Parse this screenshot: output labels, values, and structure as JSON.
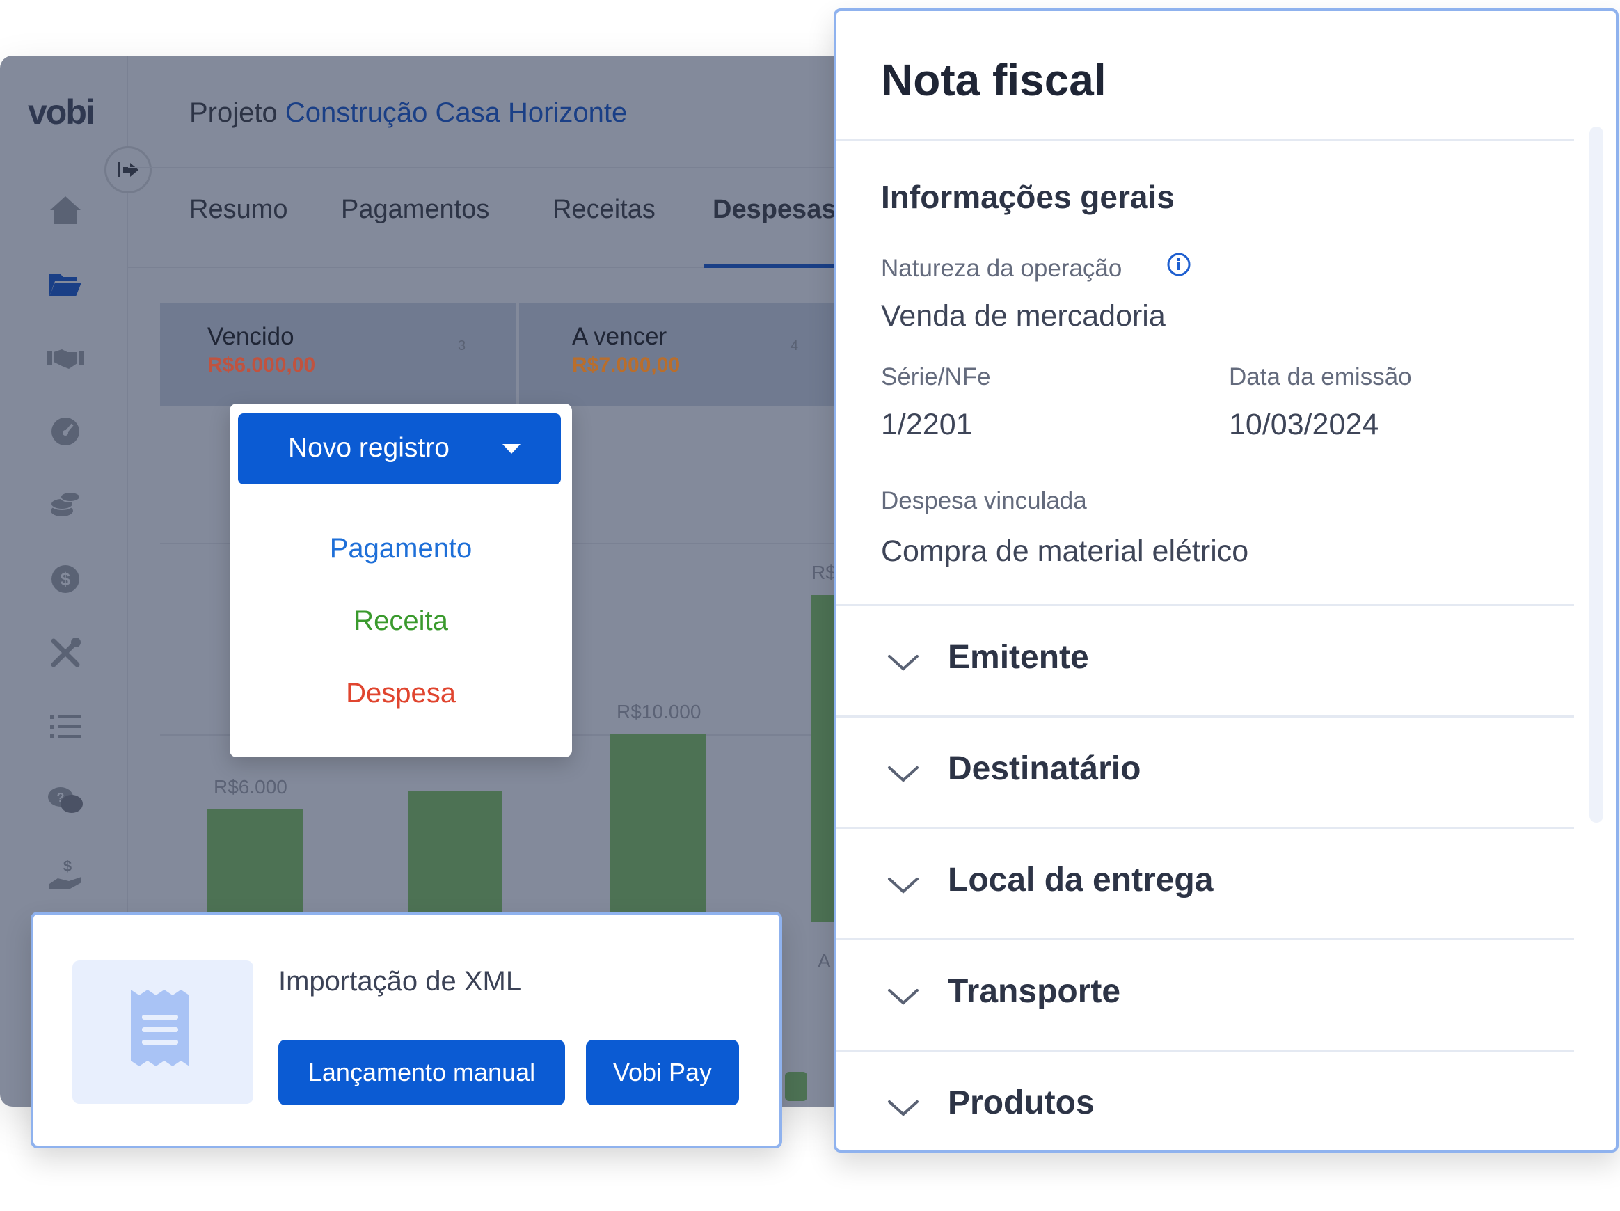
{
  "app": {
    "logo": "vobi",
    "project_prefix": "Projeto",
    "project_name": "Construção Casa Horizonte",
    "tabs": [
      {
        "label": "Resumo"
      },
      {
        "label": "Pagamentos"
      },
      {
        "label": "Receitas"
      },
      {
        "label": "Despesas"
      }
    ],
    "active_tab": "Despesas",
    "summary_cards": [
      {
        "label": "Vencido",
        "value": "R$6.000,00",
        "count": "3",
        "color": "#c0533f"
      },
      {
        "label": "A vencer",
        "value": "R$7.000,00",
        "count": "4",
        "color": "#b96e2c"
      }
    ],
    "sidebar_icons": [
      "home-icon",
      "folder-icon",
      "handshake-icon",
      "gauge-icon",
      "coins-icon",
      "dollar-icon",
      "tools-icon",
      "list-icon",
      "chat-icon",
      "hand-money-icon"
    ]
  },
  "chart_data": {
    "type": "bar",
    "categories": [
      "",
      "",
      "",
      ""
    ],
    "values": [
      6000,
      7000,
      10000,
      16000
    ],
    "data_labels": [
      "R$6.000",
      "",
      "R$10.000",
      "R$"
    ],
    "partial_axis_label": "A",
    "ylim": [
      0,
      16000
    ],
    "color": "#4d7254"
  },
  "dropdown": {
    "button_label": "Novo registro",
    "items": [
      {
        "label": "Pagamento",
        "color": "#1e6fd8"
      },
      {
        "label": "Receita",
        "color": "#3a9a2d"
      },
      {
        "label": "Despesa",
        "color": "#e0452f"
      }
    ]
  },
  "import_card": {
    "title": "Importação de XML",
    "manual_button": "Lançamento manual",
    "pay_button": "Vobi Pay"
  },
  "panel": {
    "title": "Nota fiscal",
    "section_title": "Informações gerais",
    "natureza_label": "Natureza da operação",
    "natureza_value": "Venda de mercadoria",
    "serie_label": "Série/NFe",
    "serie_value": "1/2201",
    "data_label": "Data da emissão",
    "data_value": "10/03/2024",
    "despesa_label": "Despesa vinculada",
    "despesa_value": "Compra de material elétrico",
    "accordions": [
      {
        "label": "Emitente"
      },
      {
        "label": "Destinatário"
      },
      {
        "label": "Local da entrega"
      },
      {
        "label": "Transporte"
      },
      {
        "label": "Produtos"
      }
    ]
  }
}
